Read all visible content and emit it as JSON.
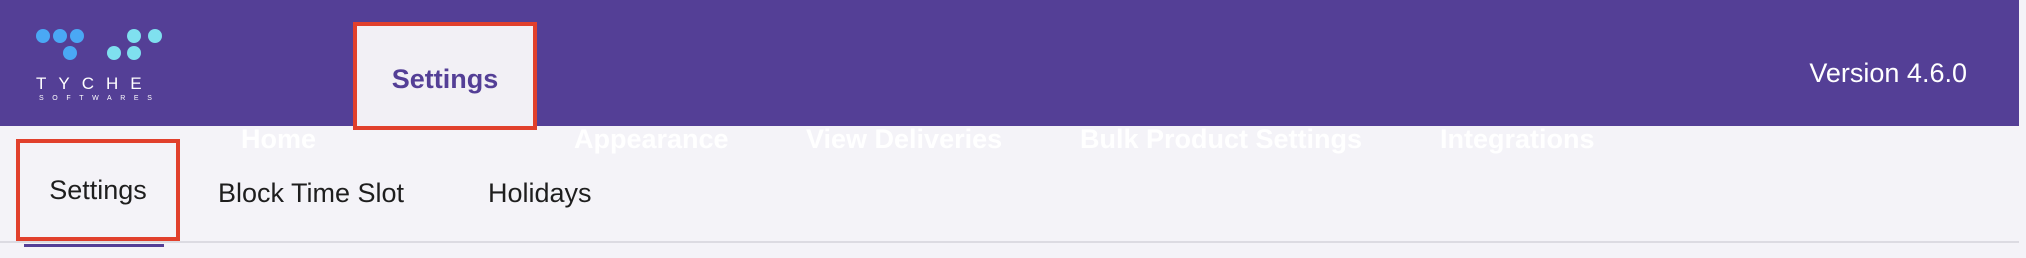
{
  "colors": {
    "brand": "#543f96",
    "highlight": "#e1402c",
    "logo_dots_primary": "#4aa8f5",
    "logo_dots_secondary": "#7fe0ef"
  },
  "logo": {
    "name": "TYCHE",
    "subtitle": "SOFTWARES"
  },
  "nav": {
    "items": [
      {
        "label": "Home"
      },
      {
        "label": "Settings",
        "active": true
      },
      {
        "label": "Appearance"
      },
      {
        "label": "View Deliveries"
      },
      {
        "label": "Bulk Product Settings"
      },
      {
        "label": "Integrations"
      }
    ],
    "version": "Version 4.6.0"
  },
  "subnav": {
    "items": [
      {
        "label": "Settings",
        "active": true
      },
      {
        "label": "Block Time Slot"
      },
      {
        "label": "Holidays"
      }
    ]
  }
}
